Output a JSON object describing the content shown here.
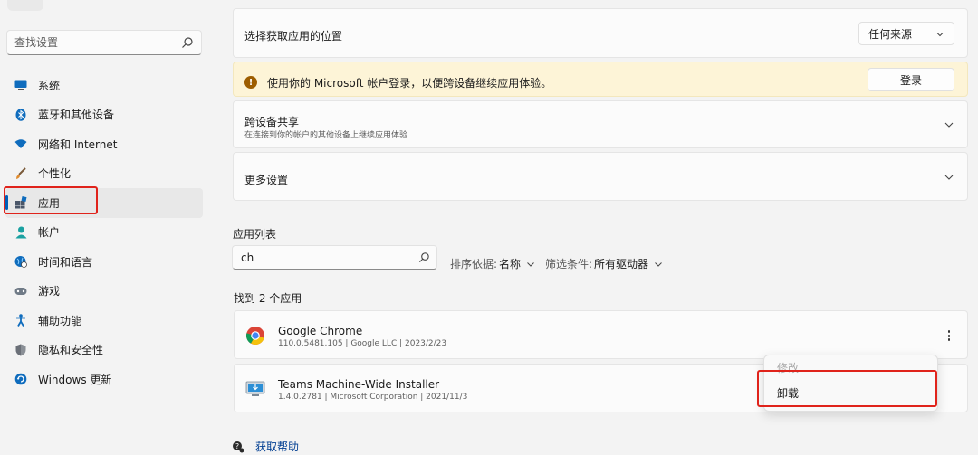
{
  "sidebar": {
    "back_icon": "back-arrow-icon",
    "search_placeholder": "查找设置",
    "items": [
      {
        "label": "系统",
        "icon": "monitor-icon"
      },
      {
        "label": "蓝牙和其他设备",
        "icon": "bluetooth-icon"
      },
      {
        "label": "网络和 Internet",
        "icon": "wifi-icon"
      },
      {
        "label": "个性化",
        "icon": "brush-icon"
      },
      {
        "label": "应用",
        "icon": "apps-icon",
        "active": true
      },
      {
        "label": "帐户",
        "icon": "person-icon"
      },
      {
        "label": "时间和语言",
        "icon": "globe-clock-icon"
      },
      {
        "label": "游戏",
        "icon": "gamepad-icon"
      },
      {
        "label": "辅助功能",
        "icon": "accessibility-icon"
      },
      {
        "label": "隐私和安全性",
        "icon": "shield-icon"
      },
      {
        "label": "Windows 更新",
        "icon": "update-icon"
      }
    ]
  },
  "main": {
    "source": {
      "title": "选择获取应用的位置",
      "dropdown_value": "任何来源"
    },
    "signin_banner": {
      "message": "使用你的 Microsoft 帐户登录，以便跨设备继续应用体验。",
      "button": "登录"
    },
    "share": {
      "title": "跨设备共享",
      "subtitle": "在连接到你的帐户的其他设备上继续应用体验"
    },
    "more_settings": {
      "title": "更多设置"
    },
    "app_list": {
      "heading": "应用列表",
      "search_value": "ch",
      "sort_label": "排序依据:",
      "sort_value": "名称",
      "filter_label": "筛选条件:",
      "filter_value": "所有驱动器",
      "found_text": "找到 2 个应用",
      "apps": [
        {
          "name": "Google Chrome",
          "meta": "110.0.5481.105  |  Google LLC  |  2023/2/23",
          "icon": "chrome-icon"
        },
        {
          "name": "Teams Machine-Wide Installer",
          "meta": "1.4.0.2781  |  Microsoft Corporation  |  2021/11/3",
          "icon": "installer-icon"
        }
      ]
    },
    "context_menu": {
      "modify": "修改",
      "uninstall": "卸载"
    },
    "help": {
      "label": "获取帮助"
    }
  },
  "colors": {
    "accent": "#005fb8",
    "highlight_box": "#e0231b",
    "banner_bg": "#fdf4d7",
    "link": "#003e92"
  }
}
